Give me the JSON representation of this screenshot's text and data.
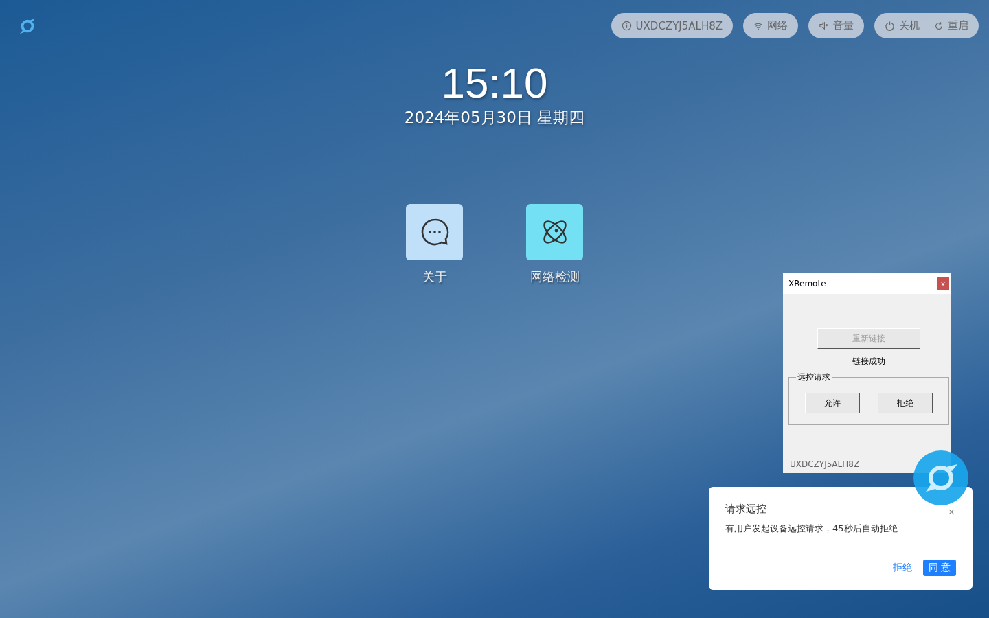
{
  "status_pills": [
    {
      "kind": "info",
      "label": "UXDCZYJ5ALH8Z"
    },
    {
      "kind": "wifi",
      "label": "网络"
    },
    {
      "kind": "volume",
      "label": "音量"
    },
    {
      "kind": "power",
      "label": "关机",
      "extra_label": "重启"
    }
  ],
  "clock": {
    "time": "15:10",
    "date": "2024年05月30日 星期四"
  },
  "apps": [
    {
      "kind": "chat",
      "label": "关于"
    },
    {
      "kind": "atom",
      "label": "网络检测"
    }
  ],
  "remote_window": {
    "title": "XRemote",
    "close": "x",
    "reconnect": {
      "label": "重新链接",
      "disabled": true
    },
    "status": "链接成功",
    "group_title": "远控请求",
    "buttons": [
      "允许",
      "拒绝"
    ],
    "device_id": "UXDCZYJ5ALH8Z"
  },
  "notification": {
    "title": "请求远控",
    "message": "有用户发起设备远控请求，45秒后自动拒绝",
    "close": "×",
    "reject": "拒绝",
    "accept": "同 意"
  }
}
